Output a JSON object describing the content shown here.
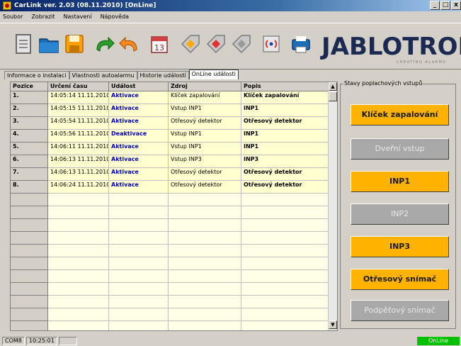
{
  "window": {
    "title": "CarLink ver. 2.03 (08.11.2010) [OnLine]",
    "minimize": "_",
    "maximize": "□",
    "close": "x"
  },
  "menu": [
    "Soubor",
    "Zobrazit",
    "Nastavení",
    "Nápověda"
  ],
  "toolbar": {
    "buttons": [
      "new-icon",
      "open-folder-icon",
      "save-icon",
      "redo-icon",
      "undo-icon",
      "calendar-icon",
      "tag-icon",
      "tag-icon",
      "tag-icon",
      "wireless-icon",
      "tool-icon",
      "print-icon"
    ],
    "calendar_day": "13",
    "logo": "JABLOTRON",
    "logo_sub": "CREATING ALARMS"
  },
  "tabs": [
    {
      "label": "Informace o instalaci",
      "active": false
    },
    {
      "label": "Vlastnosti autoalarmu",
      "active": false
    },
    {
      "label": "Historie událostí",
      "active": false
    },
    {
      "label": "OnLine události",
      "active": true
    }
  ],
  "grid": {
    "columns": [
      "Pozice",
      "Určení času",
      "Událost",
      "Zdroj",
      "Popis"
    ],
    "rows": [
      {
        "idx": "1.",
        "time": "14:05:14 11.11.2010",
        "event": "Aktivace",
        "source": "Klíček zapalování",
        "desc": "Klíček zapalování"
      },
      {
        "idx": "2.",
        "time": "14:05:15 11.11.2010",
        "event": "Aktivace",
        "source": "Vstup INP1",
        "desc": "INP1"
      },
      {
        "idx": "3.",
        "time": "14:05:54 11.11.2010",
        "event": "Aktivace",
        "source": "Otřesový detektor",
        "desc": "Otřesový detektor"
      },
      {
        "idx": "4.",
        "time": "14:05:56 11.11.2010",
        "event": "Deaktivace",
        "source": "Vstup INP1",
        "desc": "INP1"
      },
      {
        "idx": "5.",
        "time": "14:06:11 11.11.2010",
        "event": "Aktivace",
        "source": "Vstup INP1",
        "desc": "INP1"
      },
      {
        "idx": "6.",
        "time": "14:06:13 11.11.2010",
        "event": "Aktivace",
        "source": "Vstup INP3",
        "desc": "INP3"
      },
      {
        "idx": "7.",
        "time": "14:06:13 11.11.2010",
        "event": "Aktivace",
        "source": "Otřesový detektor",
        "desc": "Otřesový detektor"
      },
      {
        "idx": "8.",
        "time": "14:06:24 11.11.2010",
        "event": "Aktivace",
        "source": "Otřesový detektor",
        "desc": "Otřesový detektor"
      }
    ],
    "empty_rows": 11
  },
  "panel": {
    "title": "Stavy poplachových vstupů",
    "inputs": [
      {
        "label": "Klíček zapalování",
        "active": true
      },
      {
        "label": "Dveřní vstup",
        "active": false
      },
      {
        "label": "INP1",
        "active": true
      },
      {
        "label": "INP2",
        "active": false
      },
      {
        "label": "INP3",
        "active": true
      },
      {
        "label": "Otřesový snímač",
        "active": true
      },
      {
        "label": "Podpěťový snímač",
        "active": false
      }
    ],
    "active_color": "#ffb300",
    "inactive_color": "#a8a8a8"
  },
  "status": {
    "port": "COM8",
    "time": "10:25:01",
    "online": "OnLine",
    "online_color": "#00c000"
  }
}
